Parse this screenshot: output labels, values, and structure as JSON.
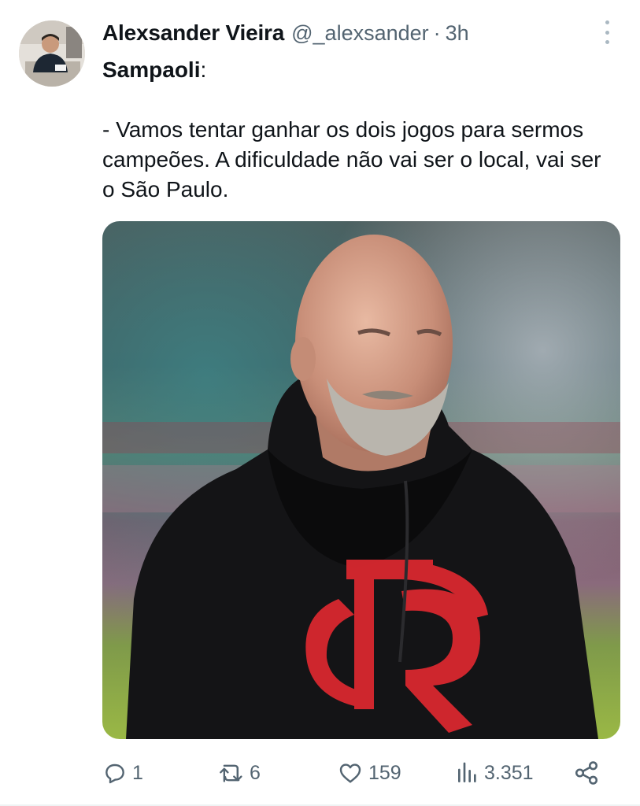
{
  "tweet": {
    "author_name": "Alexsander Vieira",
    "handle": "@_alexsander",
    "separator": "·",
    "time": "3h",
    "lead": "Sampaoli",
    "lead_suffix": ":",
    "body": "- Vamos tentar ganhar os dois jogos para sermos campeões. A dificuldade não vai ser o local, vai ser o São Paulo."
  },
  "metrics": {
    "replies": "1",
    "retweets": "6",
    "likes": "159",
    "views": "3.351"
  },
  "icons": {
    "more": "more-vertical-icon",
    "reply": "reply-bubble-icon",
    "retweet": "retweet-icon",
    "like": "heart-icon",
    "views": "views-bar-chart-icon",
    "share": "share-icon"
  },
  "colors": {
    "text_primary": "#0f1419",
    "text_secondary": "#536471",
    "crest_red": "#d8282f"
  }
}
